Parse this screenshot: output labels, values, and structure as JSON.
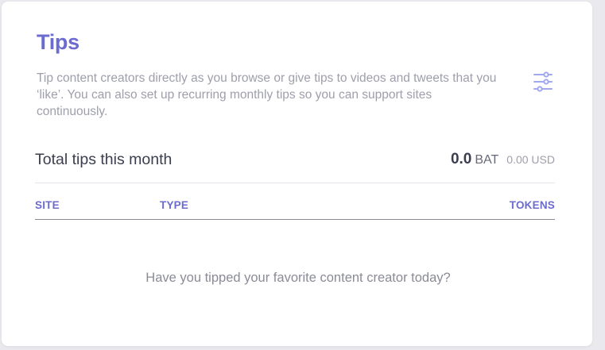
{
  "card": {
    "title": "Tips",
    "description": "Tip content creators directly as you browse or give tips to videos and tweets that you ‘like’. You can also set up recurring monthly tips so you can support sites continuously.",
    "settings_icon": "sliders-icon"
  },
  "totals": {
    "label": "Total tips this month",
    "bat_value": "0.0",
    "bat_unit": "BAT",
    "usd_value": "0.00 USD"
  },
  "table": {
    "columns": [
      "SITE",
      "TYPE",
      "TOKENS"
    ],
    "empty_message": "Have you tipped your favorite content creator today?"
  },
  "colors": {
    "accent": "#6b6bd0",
    "text_dark": "#3b3e4f",
    "text_muted": "#9e9fab",
    "icon": "#a1a8f2"
  }
}
